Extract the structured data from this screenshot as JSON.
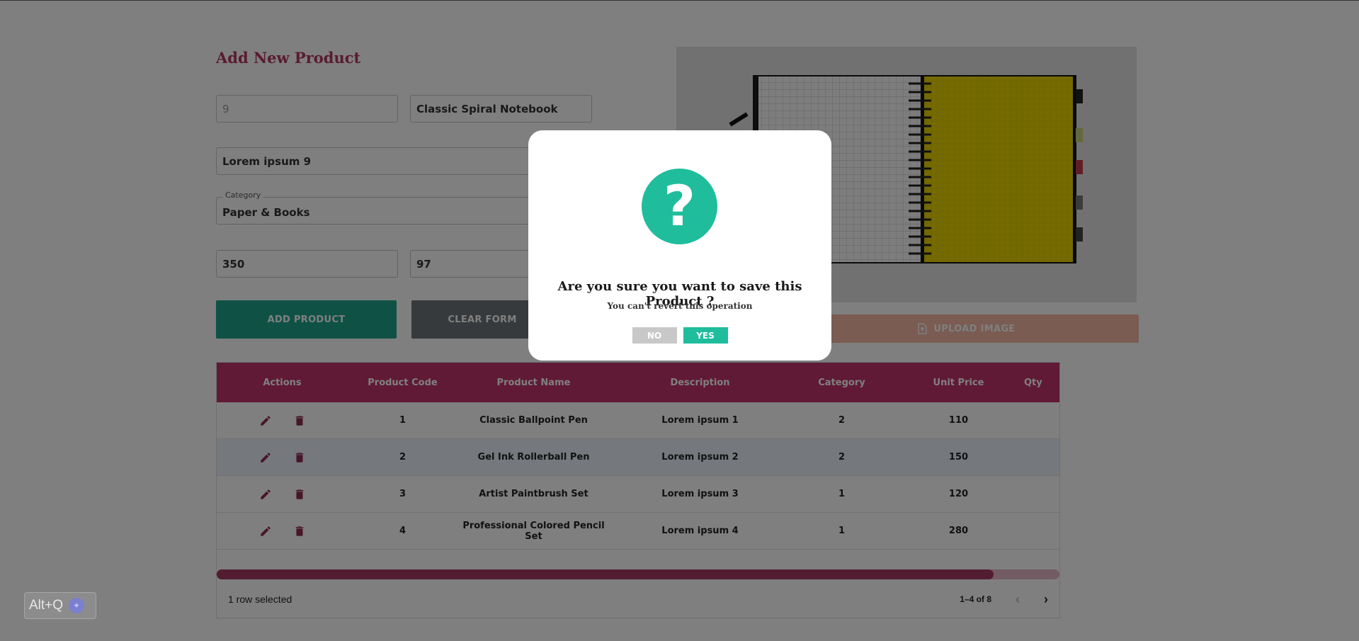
{
  "form": {
    "title": "Add New Product",
    "product_code": {
      "placeholder": "9"
    },
    "product_name": {
      "value": "Classic Spiral Notebook"
    },
    "description": {
      "value": "Lorem ipsum 9"
    },
    "category": {
      "label": "Category",
      "value": "Paper & Books"
    },
    "unit_price": {
      "value": "350"
    },
    "quantity": {
      "value": "97"
    },
    "add_button": "ADD PRODUCT",
    "clear_button": "CLEAR FORM",
    "upload_button": "UPLOAD IMAGE"
  },
  "table": {
    "columns": [
      "Actions",
      "Product Code",
      "Product Name",
      "Description",
      "Category",
      "Unit Price",
      "Qty"
    ],
    "rows": [
      {
        "code": "1",
        "name": "Classic Ballpoint Pen",
        "description": "Lorem ipsum 1",
        "category": "2",
        "price": "110"
      },
      {
        "code": "2",
        "name": "Gel Ink Rollerball Pen",
        "description": "Lorem ipsum 2",
        "category": "2",
        "price": "150"
      },
      {
        "code": "3",
        "name": "Artist Paintbrush Set",
        "description": "Lorem ipsum 3",
        "category": "1",
        "price": "120"
      },
      {
        "code": "4",
        "name": "Professional Colored Pencil Set",
        "description": "Lorem ipsum 4",
        "category": "1",
        "price": "280"
      }
    ],
    "selected_text": "1 row selected",
    "pagination": "1–4 of 8"
  },
  "dialog": {
    "icon": "?",
    "title": "Are you sure you want to save this Product ?",
    "subtitle": "You can't revert this operation",
    "no": "NO",
    "yes": "YES"
  },
  "badge": {
    "label": "Alt+Q"
  },
  "colors": {
    "brand": "#b2365f",
    "header": "#c1356b",
    "success": "#1fbd9c",
    "add_button": "#1fa58a"
  }
}
